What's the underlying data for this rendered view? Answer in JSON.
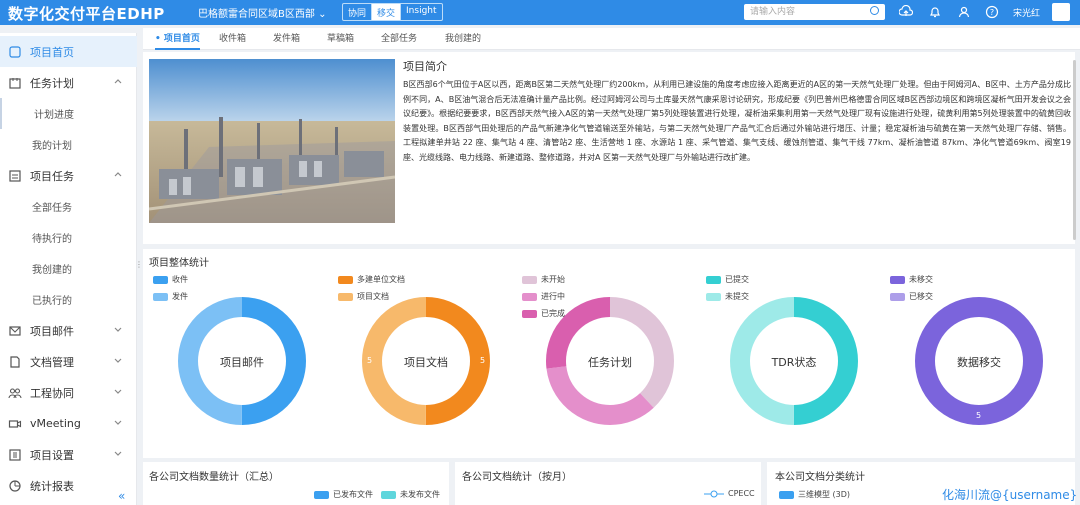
{
  "header": {
    "app_title": "数字化交付平台EDHP",
    "project": "巴格额雷合同区域B区西部",
    "segments": [
      "协同",
      "移交",
      "Insight"
    ],
    "search_placeholder": "请输入内容",
    "username": "宋光红"
  },
  "sidebar": {
    "items": [
      {
        "label": "项目首页",
        "icon": "home-icon"
      },
      {
        "label": "任务计划",
        "icon": "calendar-icon"
      },
      {
        "label": "计划进度"
      },
      {
        "label": "我的计划"
      },
      {
        "label": "项目任务",
        "icon": "task-icon"
      },
      {
        "label": "全部任务"
      },
      {
        "label": "待执行的"
      },
      {
        "label": "我创建的"
      },
      {
        "label": "已执行的"
      },
      {
        "label": "项目邮件",
        "icon": "mail-icon"
      },
      {
        "label": "文档管理",
        "icon": "document-icon"
      },
      {
        "label": "工程协同",
        "icon": "collaboration-icon"
      },
      {
        "label": "vMeeting",
        "icon": "video-icon"
      },
      {
        "label": "项目设置",
        "icon": "settings-icon"
      },
      {
        "label": "统计报表",
        "icon": "report-icon"
      }
    ]
  },
  "tabs": [
    "项目首页",
    "收件箱",
    "发件箱",
    "草稿箱",
    "全部任务",
    "我创建的"
  ],
  "intro": {
    "title": "项目简介",
    "text": "B区西部6个气田位于A区以西，距离B区第二天然气处理厂约200km，从利用已建设施的角度考虑应接入距离更近的A区的第一天然气处理厂处理。但由于阿姆河A、B区中、土方产品分成比例不同，A、B区油气混合后无法准确计量产品比例。经过阿姆河公司与土库曼天然气康采恩讨论研究，形成纪要《列巴普州巴格德雷合同区域B区西部边境区和跨境区凝析气田开发会议之会议纪要》。根据纪要要求，B区西部天然气接入A区的第一天然气处理厂第5列处理装置进行处理，凝析油采集利用第一天然气处理厂现有设施进行处理，硫黄利用第5列处理装置中的硫黄回收装置处理。B区西部气田处理后的产品气新建净化气管道输送至外输站，与第二天然气处理厂产品气汇合后通过外输站进行增压、计量；稳定凝析油与硫黄在第一天然气处理厂存储、销售。工程拟建单井站 22 座、集气站 4 座、清管站2 座、生活营地 1 座、水源站 1 座、采气管道、集气支线、缓蚀剂管道、集气干线 77km、凝析油管道 87km、净化气管道69km、阀室19座、光缆线路、电力线路、新建道路、整修道路，并对A 区第一天然气处理厂与外输站进行改扩建。"
  },
  "stats": {
    "title": "项目整体统计",
    "groups": [
      {
        "label": "项目邮件",
        "legend": [
          {
            "name": "收件",
            "color": "#3ba0f0"
          },
          {
            "name": "发件",
            "color": "#7cc0f5"
          }
        ],
        "slices": [
          0.5,
          0.5
        ],
        "inner": "",
        "side_left": "",
        "side_right": "",
        "bottom": ""
      },
      {
        "label": "项目文档",
        "legend": [
          {
            "name": "多建单位文档",
            "color": "#f2891e"
          },
          {
            "name": "项目文档",
            "color": "#f7b96b"
          }
        ],
        "slices": [
          0.5,
          0.5
        ],
        "inner": "",
        "side_left": "5",
        "side_right": "5",
        "bottom": ""
      },
      {
        "label": "任务计划",
        "legend": [
          {
            "name": "未开始",
            "color": "#e0c4d8"
          },
          {
            "name": "进行中",
            "color": "#e48fcb"
          },
          {
            "name": "已完成",
            "color": "#d95fae"
          }
        ],
        "slices": [
          0.38,
          0.35,
          0.27
        ],
        "inner": "",
        "side_left": "",
        "side_right": "",
        "bottom": ""
      },
      {
        "label": "TDR状态",
        "legend": [
          {
            "name": "已提交",
            "color": "#34cfd2"
          },
          {
            "name": "未提交",
            "color": "#9eeae8"
          }
        ],
        "slices": [
          0.5,
          0.5
        ],
        "inner": "",
        "side_left": "",
        "side_right": "",
        "bottom": ""
      },
      {
        "label": "数据移交",
        "legend": [
          {
            "name": "未移交",
            "color": "#7b64dc"
          },
          {
            "name": "已移交",
            "color": "#ad9ee9"
          }
        ],
        "slices": [
          1.0,
          0.0
        ],
        "inner": "",
        "side_left": "",
        "side_right": "",
        "bottom": "5"
      }
    ]
  },
  "cards": [
    {
      "title": "各公司文档数量统计（汇总）",
      "legend": [
        {
          "name": "已发布文件",
          "color": "#3ba0f0"
        },
        {
          "name": "未发布文件",
          "color": "#5fd6dc"
        }
      ]
    },
    {
      "title": "各公司文档统计（按月）",
      "legend": [
        {
          "name": "CPECC",
          "color": "#3ba0f0"
        }
      ]
    },
    {
      "title": "本公司文档分类统计",
      "legend": [
        {
          "name": "三维模型 (3D)",
          "color": "#3ba0f0"
        }
      ]
    }
  ],
  "watermark": "化海川流@{username}"
}
